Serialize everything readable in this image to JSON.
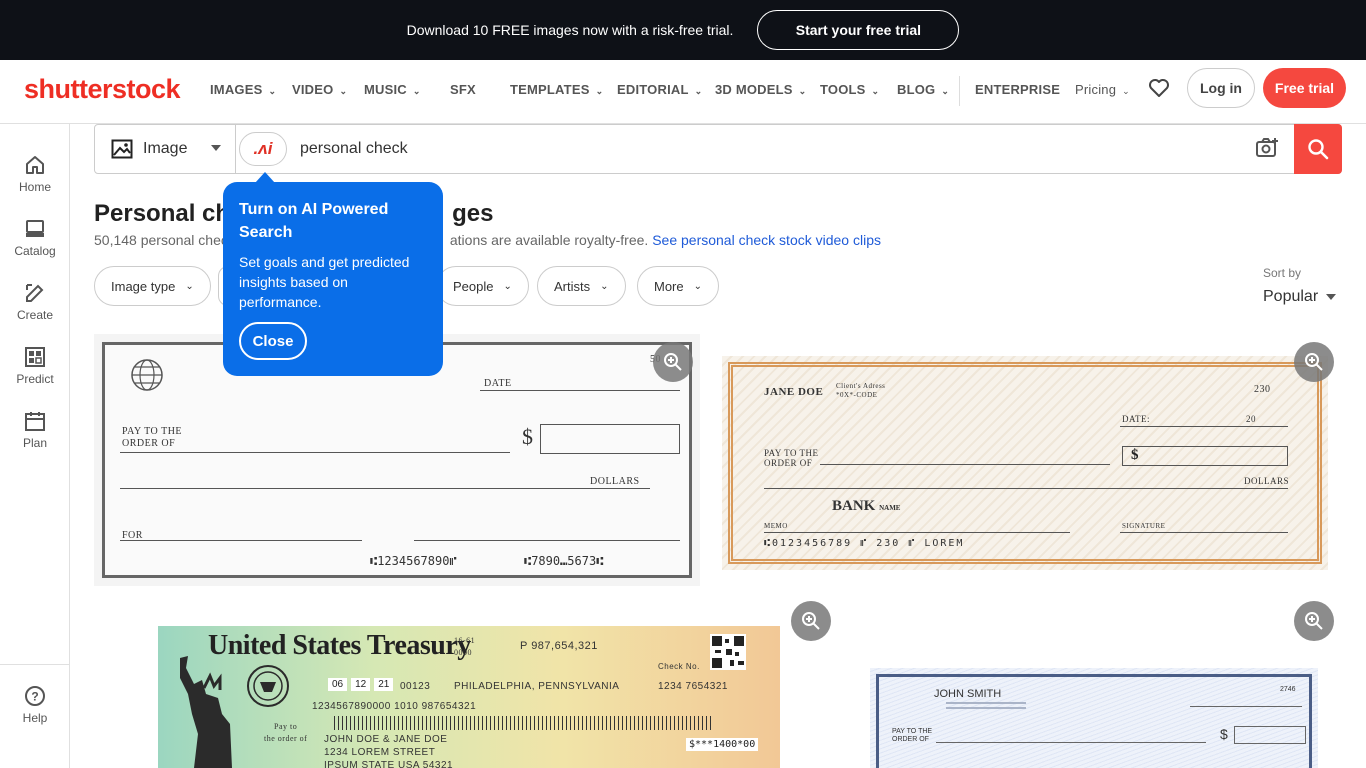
{
  "promo": {
    "text": "Download 10 FREE images now with a risk-free trial.",
    "cta": "Start your free trial"
  },
  "nav": {
    "logo": "shutterstock",
    "items": [
      "IMAGES",
      "VIDEO",
      "MUSIC",
      "SFX",
      "TEMPLATES",
      "EDITORIAL",
      "3D MODELS",
      "TOOLS",
      "BLOG",
      "ENTERPRISE",
      "Pricing"
    ],
    "login": "Log in",
    "free_trial": "Free trial"
  },
  "sidebar": {
    "items": [
      "Home",
      "Catalog",
      "Create",
      "Predict",
      "Plan"
    ],
    "help": "Help"
  },
  "search": {
    "type": "Image",
    "ai_label": ".ʌi",
    "query": "personal check"
  },
  "results": {
    "title_visible": "Personal ch",
    "title_end": "ges",
    "subtitle_start": "50,148 personal chec",
    "subtitle_mid": "ations are available royalty-free.",
    "video_link": "See personal check stock video clips"
  },
  "filters": [
    "Image type",
    "People",
    "Artists",
    "More"
  ],
  "sort": {
    "label": "Sort by",
    "value": "Popular"
  },
  "tooltip": {
    "heading": "Turn on AI Powered Search",
    "body": "Set goals and get predicted insights based on performance.",
    "close": "Close"
  },
  "check1": {
    "number": "50",
    "date": "DATE",
    "pay": "PAY TO THE",
    "order": "ORDER OF",
    "dollar": "$",
    "dollars": "DOLLARS",
    "for": "FOR",
    "micr1": "⑆1234567890⑈",
    "micr2": "⑆7890⑉5673⑆"
  },
  "check2": {
    "name": "JANE DOE",
    "addr1": "Client's Adress",
    "addr2": "*0X*-CODE",
    "number": "230",
    "date": "DATE:",
    "date_val": "20",
    "pay": "PAY TO THE",
    "order": "ORDER OF",
    "dollar": "$",
    "dollars": "DOLLARS",
    "bank": "BANK",
    "bank_sub": "NAME",
    "memo": "MEMO",
    "signature": "SIGNATURE",
    "micr": "⑆0123456789 ⑈ 230 ⑈ LOREM"
  },
  "check3": {
    "title": "United States Treasury",
    "code1": "16-61",
    "code2": "0000",
    "pnum": "P 987,654,321",
    "check_no": "Check No.",
    "date": [
      "06",
      "12",
      "21"
    ],
    "serial": "00123",
    "city": "PHILADELPHIA, PENNSYLVANIA",
    "check_num": "1234 7654321",
    "routing": "1234567890000 1010 987654321",
    "pay": "Pay to",
    "order": "the order of",
    "payee1": "JOHN DOE & JANE DOE",
    "payee2": "1234 LOREM STREET",
    "payee3": "IPSUM STATE USA 54321",
    "amount": "$***1400*00"
  },
  "check4": {
    "name": "JOHN SMITH",
    "number": "2746",
    "pay": "PAY TO THE",
    "order": "ORDER OF",
    "dollar": "$"
  }
}
